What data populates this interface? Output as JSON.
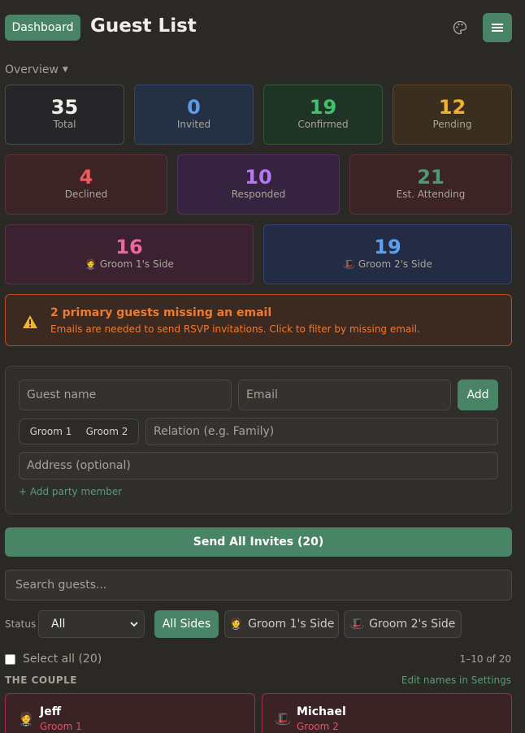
{
  "header": {
    "dashboard_label": "Dashboard",
    "title": "Guest List",
    "palette_icon": "palette-icon",
    "menu_icon": "hamburger-menu-icon"
  },
  "overview": {
    "label": "Overview",
    "stats_row1": [
      {
        "value": "35",
        "label": "Total",
        "color": "#f2efe7"
      },
      {
        "value": "0",
        "label": "Invited",
        "color": "#5a9ee8"
      },
      {
        "value": "19",
        "label": "Confirmed",
        "color": "#3ec46d"
      },
      {
        "value": "12",
        "label": "Pending",
        "color": "#f0b429"
      }
    ],
    "stats_row2": [
      {
        "value": "4",
        "label": "Declined",
        "color": "#f05a5a"
      },
      {
        "value": "10",
        "label": "Responded",
        "color": "#b678f0"
      },
      {
        "value": "21",
        "label": "Est. Attending",
        "color": "#4a9a76"
      }
    ],
    "stats_row3": [
      {
        "value": "16",
        "label": "Groom 1's Side",
        "color": "#f064a0",
        "icon": "groom-suit-icon"
      },
      {
        "value": "19",
        "label": "Groom 2's Side",
        "color": "#5aa0f0",
        "icon": "top-hat-icon"
      }
    ]
  },
  "alert": {
    "title": "2 primary guests missing an email",
    "message": "Emails are needed to send RSVP invitations. Click to filter by missing email.",
    "icon": "warning-icon"
  },
  "form": {
    "name_placeholder": "Guest name",
    "email_placeholder": "Email",
    "add_label": "Add",
    "side_options": [
      "Groom 1",
      "Groom 2"
    ],
    "relation_placeholder": "Relation (e.g. Family)",
    "address_placeholder": "Address (optional)",
    "add_member_label": "+ Add party member"
  },
  "send_invites_label": "Send All Invites (20)",
  "search_placeholder": "Search guests...",
  "filters": {
    "status_label": "Status",
    "status_value": "All",
    "chips": [
      {
        "label": "All Sides",
        "active": true
      },
      {
        "label": "Groom 1's Side",
        "icon": "groom-suit-icon",
        "active": false
      },
      {
        "label": "Groom 2's Side",
        "icon": "top-hat-icon",
        "active": false
      }
    ]
  },
  "list": {
    "select_all_label": "Select all (20)",
    "range_label": "1–10 of 20",
    "couple_header": "THE COUPLE",
    "edit_names_label": "Edit names in Settings",
    "couple": [
      {
        "name": "Jeff",
        "side": "Groom 1",
        "icon": "groom-suit-icon"
      },
      {
        "name": "Michael",
        "side": "Groom 2",
        "icon": "top-hat-icon"
      }
    ]
  }
}
